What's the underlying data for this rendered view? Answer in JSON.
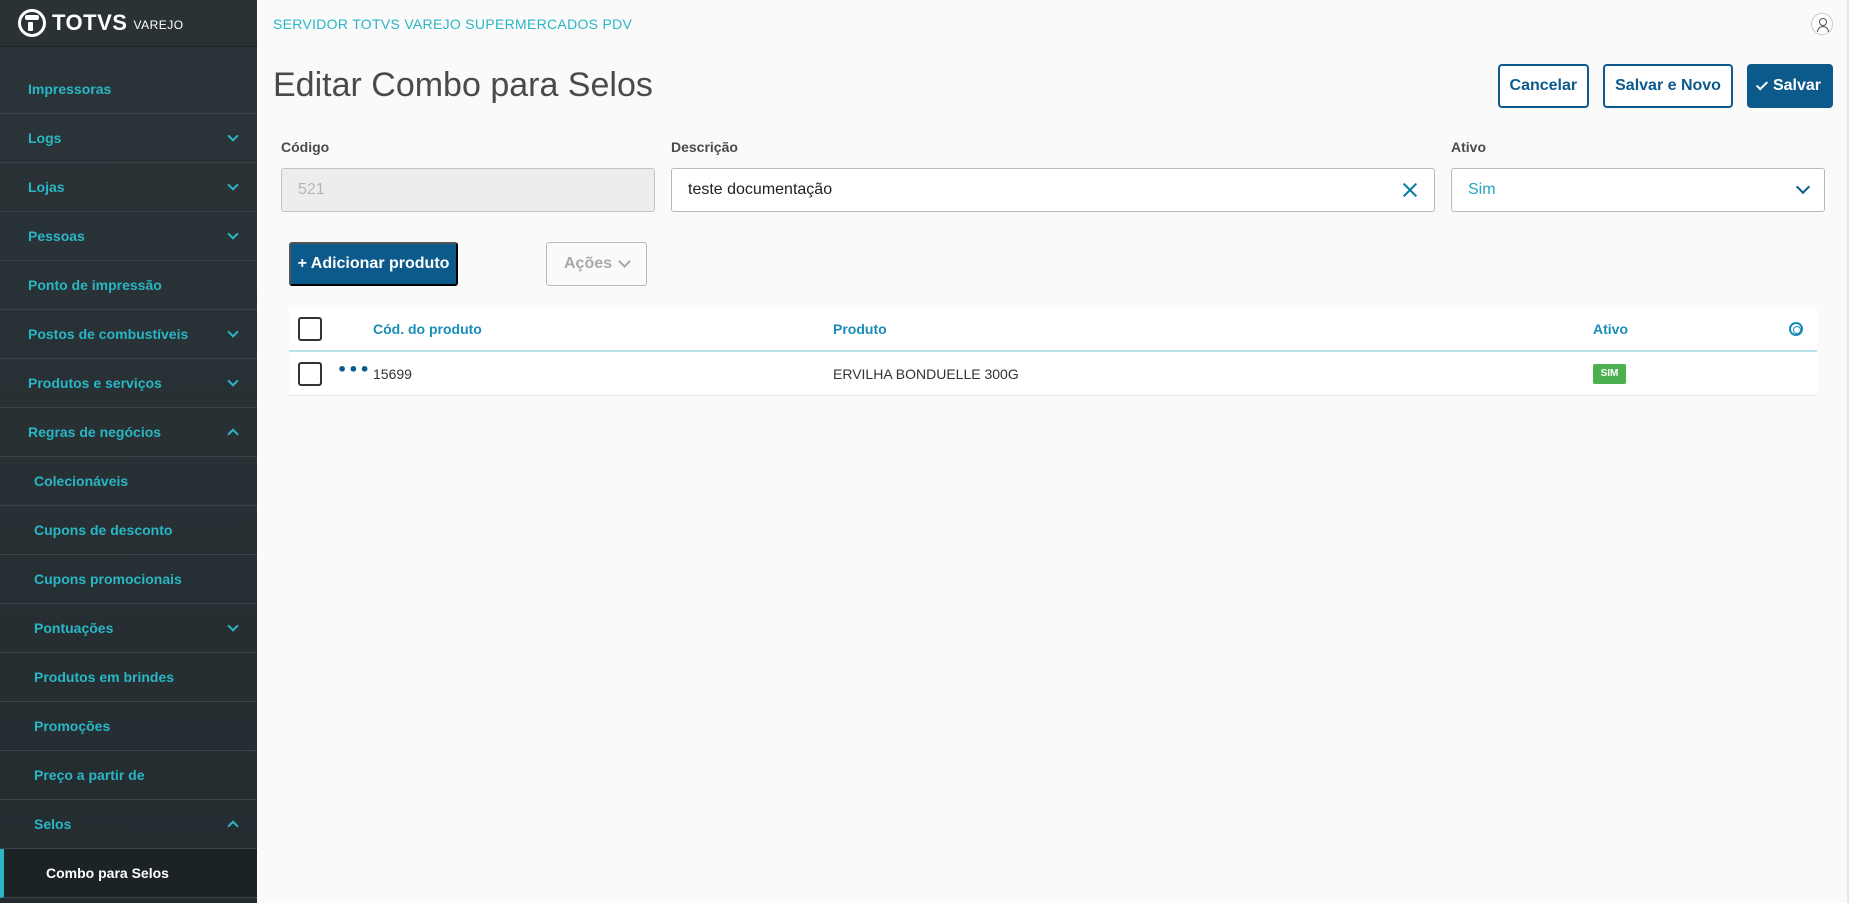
{
  "logo": {
    "brand": "TOTVS",
    "sub": "VAREJO"
  },
  "header": {
    "server": "SERVIDOR TOTVS VAREJO SUPERMERCADOS PDV"
  },
  "sidebar": {
    "items": [
      {
        "label": "Impressoras",
        "expand": ""
      },
      {
        "label": "Logs",
        "expand": "down"
      },
      {
        "label": "Lojas",
        "expand": "down"
      },
      {
        "label": "Pessoas",
        "expand": "down"
      },
      {
        "label": "Ponto de impressão",
        "expand": ""
      },
      {
        "label": "Postos de combustíveis",
        "expand": "down"
      },
      {
        "label": "Produtos e serviços",
        "expand": "down"
      },
      {
        "label": "Regras de negócios",
        "expand": "up"
      },
      {
        "label": "Colecionáveis",
        "expand": ""
      },
      {
        "label": "Cupons de desconto",
        "expand": ""
      },
      {
        "label": "Cupons promocionais",
        "expand": ""
      },
      {
        "label": "Pontuações",
        "expand": "down"
      },
      {
        "label": "Produtos em brindes",
        "expand": ""
      },
      {
        "label": "Promoções",
        "expand": ""
      },
      {
        "label": "Preço a partir de",
        "expand": ""
      },
      {
        "label": "Selos",
        "expand": "up"
      },
      {
        "label": "Combo para Selos",
        "expand": ""
      }
    ]
  },
  "page": {
    "title": "Editar Combo para Selos"
  },
  "toolbar": {
    "cancel": "Cancelar",
    "save_new": "Salvar e Novo",
    "save": "Salvar"
  },
  "form": {
    "codigo": {
      "label": "Código",
      "value": "521"
    },
    "descricao": {
      "label": "Descrição",
      "value": "teste documentação"
    },
    "ativo": {
      "label": "Ativo",
      "value": "Sim"
    }
  },
  "buttons": {
    "add_product": "+ Adicionar produto",
    "acoes": "Ações"
  },
  "table": {
    "headers": {
      "codigo": "Cód. do produto",
      "produto": "Produto",
      "ativo": "Ativo"
    },
    "rows": [
      {
        "codigo": "15699",
        "produto": "ERVILHA BONDUELLE 300G",
        "ativo": "SIM",
        "ativo_color": "#4caf50"
      }
    ]
  }
}
